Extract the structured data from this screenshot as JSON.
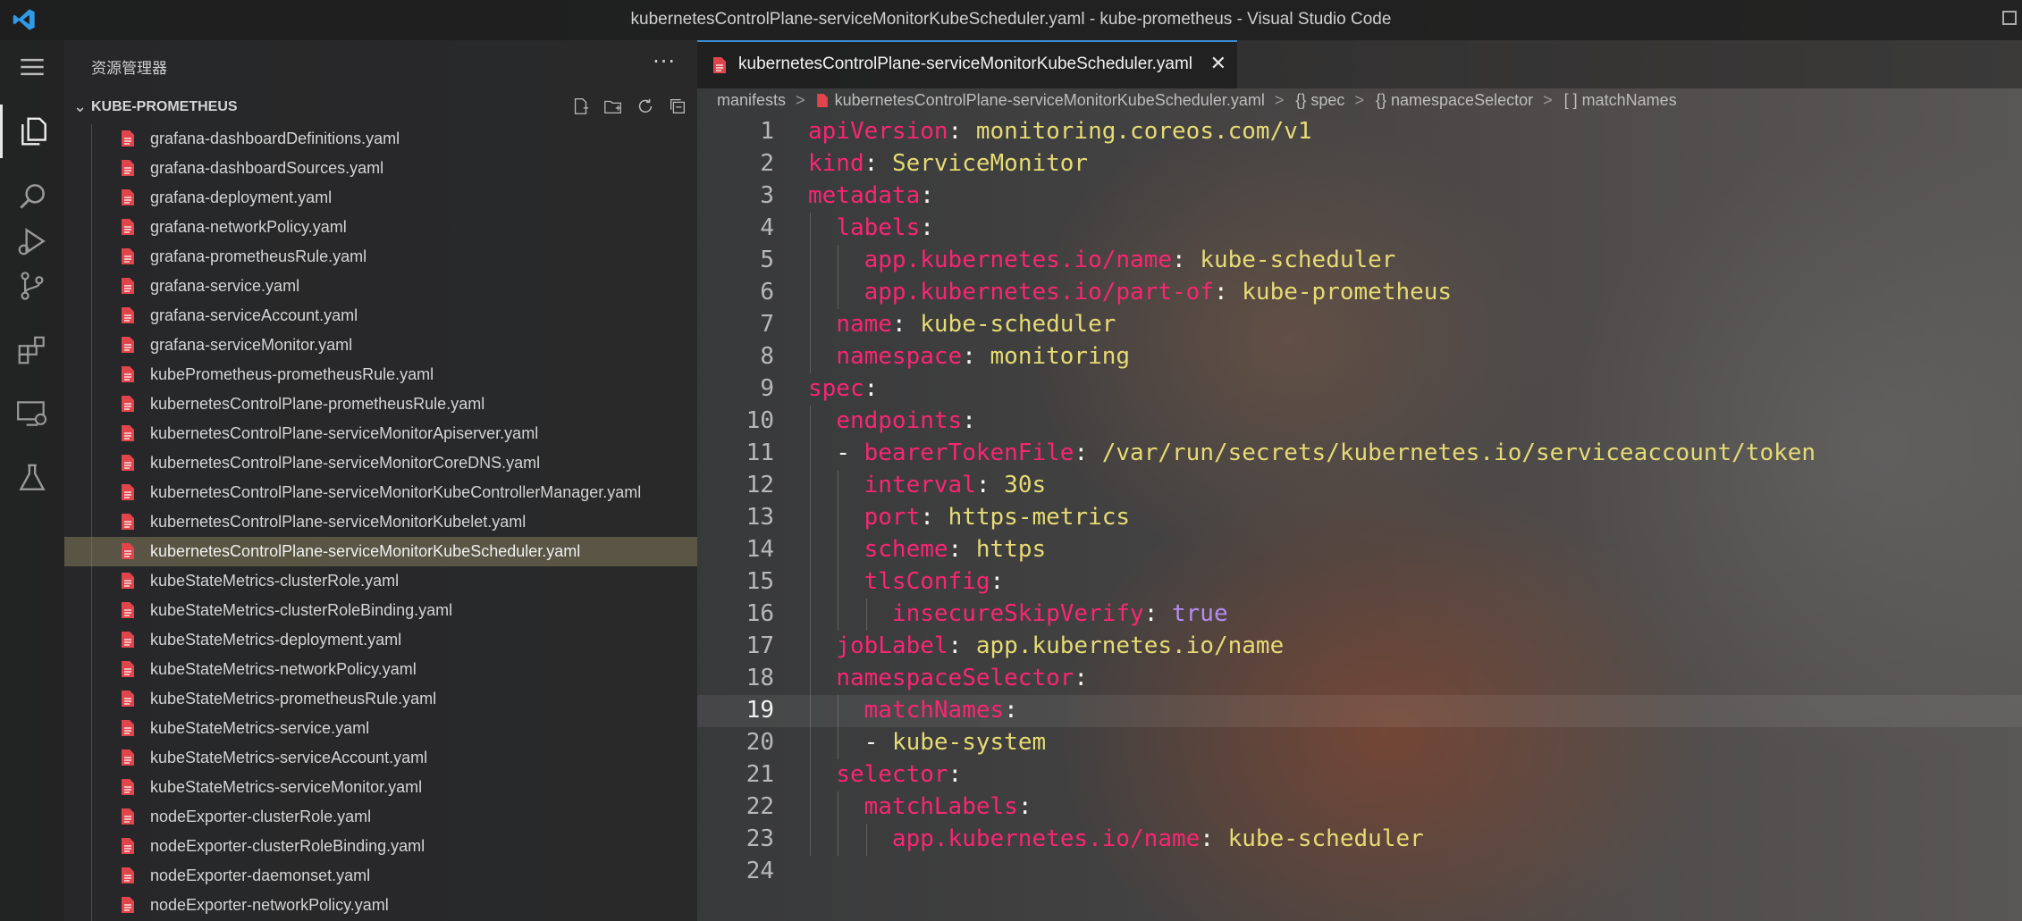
{
  "window": {
    "title": "kubernetesControlPlane-serviceMonitorKubeScheduler.yaml - kube-prometheus - Visual Studio Code",
    "app_icon": "vscode-icon"
  },
  "activity_bar": {
    "items": [
      {
        "icon": "menu-icon"
      },
      {
        "icon": "explorer-icon"
      },
      {
        "icon": "search-icon"
      },
      {
        "icon": "run-debug-icon"
      },
      {
        "icon": "source-control-icon"
      },
      {
        "icon": "extensions-icon"
      },
      {
        "icon": "remote-explorer-icon"
      },
      {
        "icon": "testing-icon"
      }
    ]
  },
  "sidebar": {
    "title": "资源管理器",
    "more_icon": "···",
    "section": "KUBE-PROMETHEUS",
    "actions": [
      "new-file-icon",
      "new-folder-icon",
      "refresh-icon",
      "collapse-all-icon"
    ],
    "files": [
      "grafana-dashboardDefinitions.yaml",
      "grafana-dashboardSources.yaml",
      "grafana-deployment.yaml",
      "grafana-networkPolicy.yaml",
      "grafana-prometheusRule.yaml",
      "grafana-service.yaml",
      "grafana-serviceAccount.yaml",
      "grafana-serviceMonitor.yaml",
      "kubePrometheus-prometheusRule.yaml",
      "kubernetesControlPlane-prometheusRule.yaml",
      "kubernetesControlPlane-serviceMonitorApiserver.yaml",
      "kubernetesControlPlane-serviceMonitorCoreDNS.yaml",
      "kubernetesControlPlane-serviceMonitorKubeControllerManager.yaml",
      "kubernetesControlPlane-serviceMonitorKubelet.yaml",
      "kubernetesControlPlane-serviceMonitorKubeScheduler.yaml",
      "kubeStateMetrics-clusterRole.yaml",
      "kubeStateMetrics-clusterRoleBinding.yaml",
      "kubeStateMetrics-deployment.yaml",
      "kubeStateMetrics-networkPolicy.yaml",
      "kubeStateMetrics-prometheusRule.yaml",
      "kubeStateMetrics-service.yaml",
      "kubeStateMetrics-serviceAccount.yaml",
      "kubeStateMetrics-serviceMonitor.yaml",
      "nodeExporter-clusterRole.yaml",
      "nodeExporter-clusterRoleBinding.yaml",
      "nodeExporter-daemonset.yaml",
      "nodeExporter-networkPolicy.yaml"
    ],
    "selected_file": "kubernetesControlPlane-serviceMonitorKubeScheduler.yaml"
  },
  "tab": {
    "label": "kubernetesControlPlane-serviceMonitorKubeScheduler.yaml",
    "close": "✕"
  },
  "breadcrumb": {
    "folder": "manifests",
    "file": "kubernetesControlPlane-serviceMonitorKubeScheduler.yaml",
    "spec": "{} spec",
    "namespaceSelector": "{} namespaceSelector",
    "matchNames": "[ ] matchNames",
    "separator": ">"
  },
  "editor": {
    "current_line": 19,
    "lines": [
      {
        "indent": 0,
        "parts": [
          [
            "k",
            "apiVersion"
          ],
          [
            "p",
            ": "
          ],
          [
            "v",
            "monitoring.coreos.com/v1"
          ]
        ]
      },
      {
        "indent": 0,
        "parts": [
          [
            "k",
            "kind"
          ],
          [
            "p",
            ": "
          ],
          [
            "v",
            "ServiceMonitor"
          ]
        ]
      },
      {
        "indent": 0,
        "parts": [
          [
            "k",
            "metadata"
          ],
          [
            "p",
            ":"
          ]
        ]
      },
      {
        "indent": 1,
        "parts": [
          [
            "k",
            "labels"
          ],
          [
            "p",
            ":"
          ]
        ]
      },
      {
        "indent": 2,
        "parts": [
          [
            "k",
            "app.kubernetes.io/name"
          ],
          [
            "p",
            ": "
          ],
          [
            "v",
            "kube-scheduler"
          ]
        ]
      },
      {
        "indent": 2,
        "parts": [
          [
            "k",
            "app.kubernetes.io/part-of"
          ],
          [
            "p",
            ": "
          ],
          [
            "v",
            "kube-prometheus"
          ]
        ]
      },
      {
        "indent": 1,
        "parts": [
          [
            "k",
            "name"
          ],
          [
            "p",
            ": "
          ],
          [
            "v",
            "kube-scheduler"
          ]
        ]
      },
      {
        "indent": 1,
        "parts": [
          [
            "k",
            "namespace"
          ],
          [
            "p",
            ": "
          ],
          [
            "v",
            "monitoring"
          ]
        ]
      },
      {
        "indent": 0,
        "parts": [
          [
            "k",
            "spec"
          ],
          [
            "p",
            ":"
          ]
        ]
      },
      {
        "indent": 1,
        "parts": [
          [
            "k",
            "endpoints"
          ],
          [
            "p",
            ":"
          ]
        ]
      },
      {
        "indent": 1,
        "parts": [
          [
            "p",
            "- "
          ],
          [
            "k",
            "bearerTokenFile"
          ],
          [
            "p",
            ": "
          ],
          [
            "v",
            "/var/run/secrets/kubernetes.io/serviceaccount/token"
          ]
        ]
      },
      {
        "indent": 2,
        "parts": [
          [
            "k",
            "interval"
          ],
          [
            "p",
            ": "
          ],
          [
            "v",
            "30s"
          ]
        ]
      },
      {
        "indent": 2,
        "parts": [
          [
            "k",
            "port"
          ],
          [
            "p",
            ": "
          ],
          [
            "v",
            "https-metrics"
          ]
        ]
      },
      {
        "indent": 2,
        "parts": [
          [
            "k",
            "scheme"
          ],
          [
            "p",
            ": "
          ],
          [
            "v",
            "https"
          ]
        ]
      },
      {
        "indent": 2,
        "parts": [
          [
            "k",
            "tlsConfig"
          ],
          [
            "p",
            ":"
          ]
        ]
      },
      {
        "indent": 3,
        "parts": [
          [
            "k",
            "insecureSkipVerify"
          ],
          [
            "p",
            ": "
          ],
          [
            "n",
            "true"
          ]
        ]
      },
      {
        "indent": 1,
        "parts": [
          [
            "k",
            "jobLabel"
          ],
          [
            "p",
            ": "
          ],
          [
            "v",
            "app.kubernetes.io/name"
          ]
        ]
      },
      {
        "indent": 1,
        "parts": [
          [
            "k",
            "namespaceSelector"
          ],
          [
            "p",
            ":"
          ]
        ]
      },
      {
        "indent": 2,
        "parts": [
          [
            "k",
            "matchNames"
          ],
          [
            "p",
            ":"
          ]
        ]
      },
      {
        "indent": 2,
        "parts": [
          [
            "p",
            "- "
          ],
          [
            "v",
            "kube-system"
          ]
        ]
      },
      {
        "indent": 1,
        "parts": [
          [
            "k",
            "selector"
          ],
          [
            "p",
            ":"
          ]
        ]
      },
      {
        "indent": 2,
        "parts": [
          [
            "k",
            "matchLabels"
          ],
          [
            "p",
            ":"
          ]
        ]
      },
      {
        "indent": 3,
        "parts": [
          [
            "k",
            "app.kubernetes.io/name"
          ],
          [
            "p",
            ": "
          ],
          [
            "v",
            "kube-scheduler"
          ]
        ]
      },
      {
        "indent": 0,
        "parts": []
      }
    ]
  }
}
